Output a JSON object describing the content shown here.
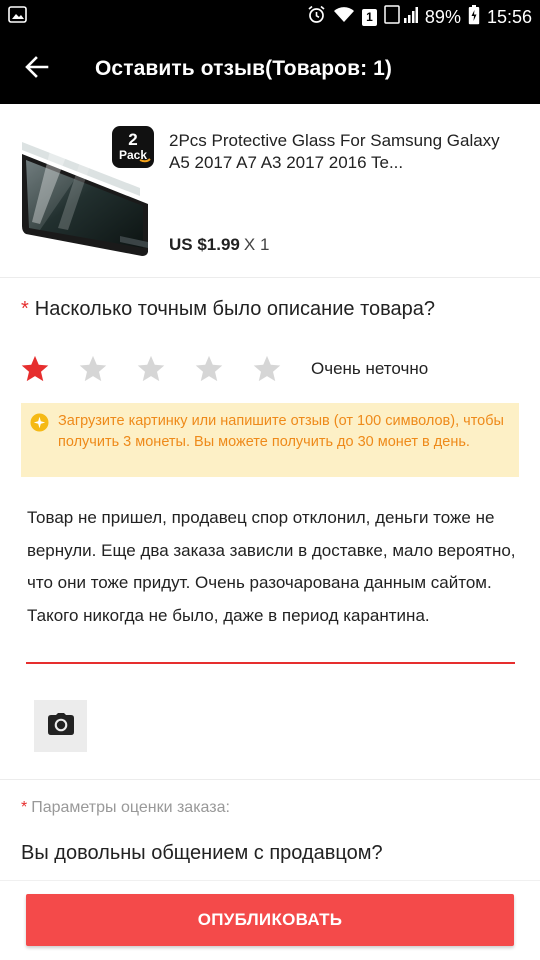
{
  "status_bar": {
    "battery": "89%",
    "time": "15:56",
    "sim_badge": "1",
    "icons": [
      "gallery-icon",
      "alarm-icon",
      "wifi-icon",
      "sim-icon",
      "signal-icon",
      "battery-icon"
    ]
  },
  "header": {
    "back_icon": "arrow-left-icon",
    "title": "Оставить отзыв(Товаров: 1)"
  },
  "product": {
    "title": "2Pcs Protective Glass For Samsung Galaxy A5 2017 A7 A3 2017 2016 Te...",
    "price": "US $1.99",
    "quantity": "X 1",
    "pack_badge_number": "2",
    "pack_badge_text": "Pack"
  },
  "rating": {
    "question": "Насколько точным было описание товара?",
    "required_mark": "*",
    "selected_stars": 1,
    "max_stars": 5,
    "label": "Очень неточно",
    "star_active_color": "#e62e2e",
    "star_inactive_color": "#d6d6d6"
  },
  "notice": {
    "text": "Загрузите картинку или напишите отзыв (от 100 символов), чтобы получить 3 монеты. Вы можете получить до 30 монет в день."
  },
  "review": {
    "text": "Товар не пришел, продавец спор отклонил, деньги тоже не вернули. Еще два заказа зависли в доставке, мало вероятно, что они тоже придут. Очень разочарована данным сайтом. Такого никогда не было, даже в период карантина."
  },
  "upload": {
    "icon": "camera-icon"
  },
  "params": {
    "required_mark": "*",
    "label": "Параметры оценки заказа:",
    "question": "Вы довольны общением с продавцом?"
  },
  "footer": {
    "publish_label": "ОПУБЛИКОВАТЬ"
  },
  "colors": {
    "accent": "#f44a4a",
    "required": "#e62e2e",
    "notice_bg": "#fdf0c6",
    "notice_text": "#ee8a1a"
  }
}
